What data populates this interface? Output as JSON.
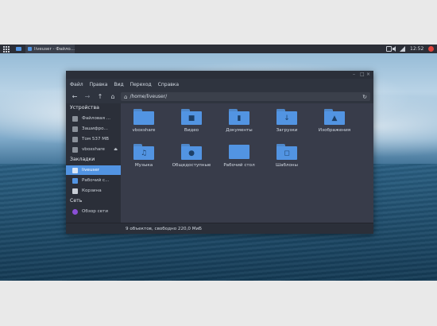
{
  "panel": {
    "task_title": "liveuser - Файло...",
    "clock": "12:52"
  },
  "window": {
    "menu": [
      "Файл",
      "Правка",
      "Вид",
      "Переход",
      "Справка"
    ],
    "path": "/home/liveuser/",
    "sidebar": {
      "devices_heading": "Устройства",
      "devices": [
        "Файловая ...",
        "Зашифро...",
        "Том 537 MB",
        "vboxshare"
      ],
      "bookmarks_heading": "Закладки",
      "bookmarks": [
        "liveuser",
        "Рабочий с...",
        "Корзина"
      ],
      "network_heading": "Сеть",
      "network": [
        "Обзор сети"
      ]
    },
    "items": [
      {
        "label": "vboxshare",
        "icon": "folder-icon"
      },
      {
        "label": "Видео",
        "icon": "video-folder-icon"
      },
      {
        "label": "Документы",
        "icon": "documents-folder-icon"
      },
      {
        "label": "Загрузки",
        "icon": "downloads-folder-icon"
      },
      {
        "label": "Изображения",
        "icon": "pictures-folder-icon"
      },
      {
        "label": "Музыка",
        "icon": "music-folder-icon"
      },
      {
        "label": "Общедоступные",
        "icon": "public-folder-icon"
      },
      {
        "label": "Рабочий стол",
        "icon": "desktop-folder-icon"
      },
      {
        "label": "Шаблоны",
        "icon": "templates-folder-icon"
      }
    ],
    "status": "9 объектов, свободно 220,0 МиБ"
  },
  "colors": {
    "accent": "#5294e2",
    "window_bg": "#383c4a",
    "sidebar_bg": "#2b2f39"
  }
}
